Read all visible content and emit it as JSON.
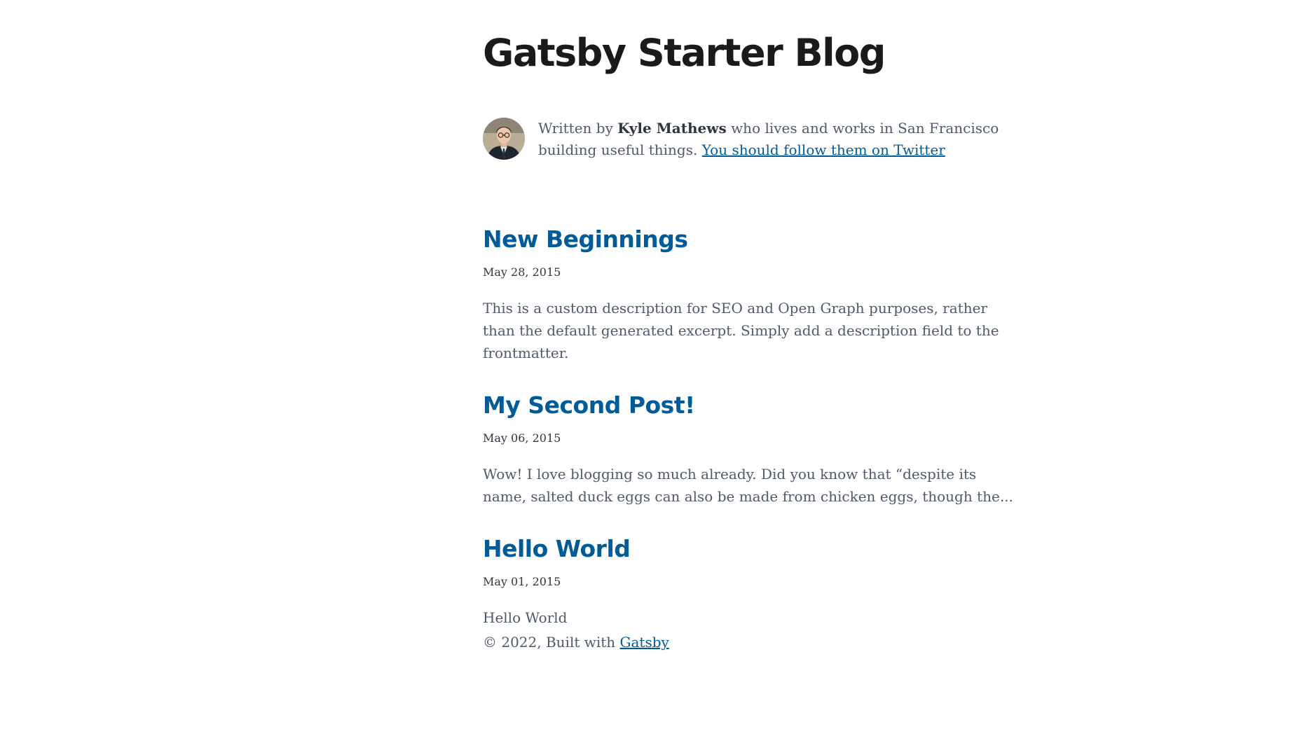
{
  "header": {
    "title": "Gatsby Starter Blog"
  },
  "bio": {
    "prefix": "Written by",
    "author": "Kyle Mathews",
    "suffix": "who lives and works in San Francisco building useful things.",
    "twitter_link": "You should follow them on Twitter",
    "avatar_icon": "author-avatar"
  },
  "posts": [
    {
      "title": "New Beginnings",
      "date": "May 28, 2015",
      "description": "This is a custom description for SEO and Open Graph purposes, rather than the default generated excerpt. Simply add a description field to the frontmatter."
    },
    {
      "title": "My Second Post!",
      "date": "May 06, 2015",
      "description": "Wow! I love blogging so much already. Did you know that “despite its name, salted duck eggs can also be made from chicken eggs, though the..."
    },
    {
      "title": "Hello World",
      "date": "May 01, 2015",
      "description": "Hello World"
    }
  ],
  "footer": {
    "text": "© 2022, Built with",
    "link": "Gatsby"
  },
  "colors": {
    "link": "#005b99",
    "text": "#4f5969",
    "heading": "#1a1a1a"
  }
}
